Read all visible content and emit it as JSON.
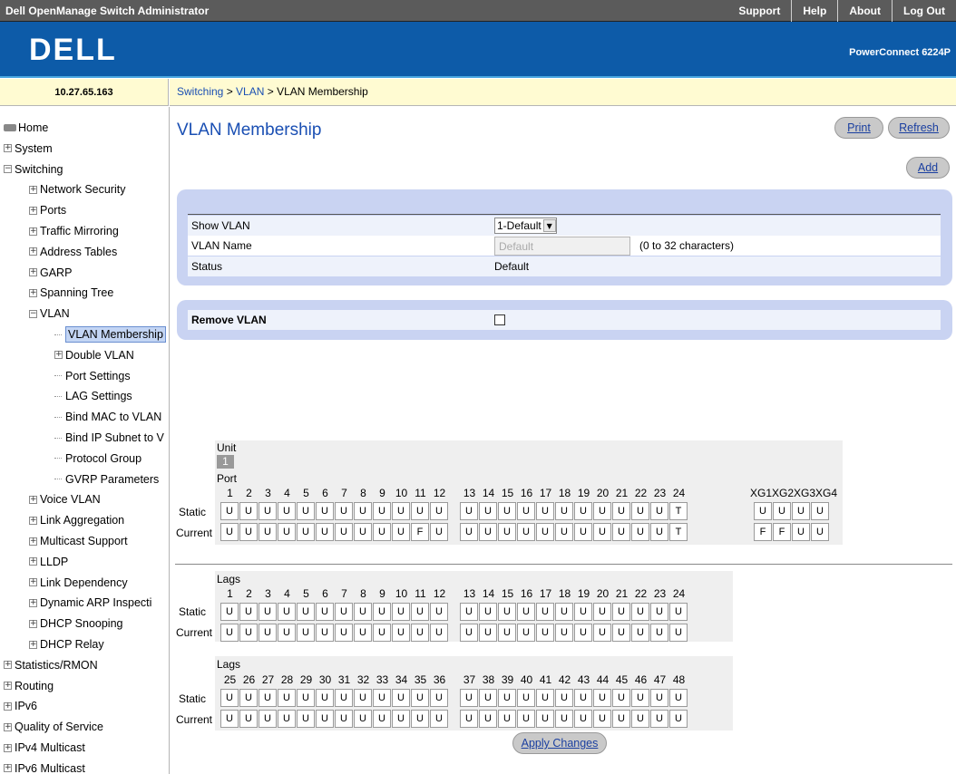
{
  "header": {
    "app_title": "Dell OpenManage Switch Administrator",
    "links": [
      "Support",
      "Help",
      "About",
      "Log Out"
    ],
    "logo": "DELL",
    "model": "PowerConnect 6224P"
  },
  "ip": "10.27.65.163",
  "breadcrumb": [
    "Switching",
    "VLAN",
    "VLAN Membership"
  ],
  "breadcrumb_sep": " > ",
  "sidebar": {
    "items": [
      {
        "label": "Home",
        "level": 0,
        "box": "icon"
      },
      {
        "label": "System",
        "level": 0,
        "box": "+"
      },
      {
        "label": "Switching",
        "level": 0,
        "box": "-"
      },
      {
        "label": "Network Security",
        "level": 1,
        "box": "+"
      },
      {
        "label": "Ports",
        "level": 1,
        "box": "+"
      },
      {
        "label": "Traffic Mirroring",
        "level": 1,
        "box": "+"
      },
      {
        "label": "Address Tables",
        "level": 1,
        "box": "+"
      },
      {
        "label": "GARP",
        "level": 1,
        "box": "+"
      },
      {
        "label": "Spanning Tree",
        "level": 1,
        "box": "+"
      },
      {
        "label": "VLAN",
        "level": 1,
        "box": "-"
      },
      {
        "label": "VLAN Membership",
        "level": 2,
        "box": "",
        "selected": true
      },
      {
        "label": "Double VLAN",
        "level": 2,
        "box": "+"
      },
      {
        "label": "Port Settings",
        "level": 2,
        "box": ""
      },
      {
        "label": "LAG Settings",
        "level": 2,
        "box": ""
      },
      {
        "label": "Bind MAC to VLAN",
        "level": 2,
        "box": ""
      },
      {
        "label": "Bind IP Subnet to V",
        "level": 2,
        "box": ""
      },
      {
        "label": "Protocol Group",
        "level": 2,
        "box": ""
      },
      {
        "label": "GVRP Parameters",
        "level": 2,
        "box": ""
      },
      {
        "label": "Voice VLAN",
        "level": 1,
        "box": "+"
      },
      {
        "label": "Link Aggregation",
        "level": 1,
        "box": "+"
      },
      {
        "label": "Multicast Support",
        "level": 1,
        "box": "+"
      },
      {
        "label": "LLDP",
        "level": 1,
        "box": "+"
      },
      {
        "label": "Link Dependency",
        "level": 1,
        "box": "+"
      },
      {
        "label": "Dynamic ARP Inspecti",
        "level": 1,
        "box": "+"
      },
      {
        "label": "DHCP Snooping",
        "level": 1,
        "box": "+"
      },
      {
        "label": "DHCP Relay",
        "level": 1,
        "box": "+"
      },
      {
        "label": "Statistics/RMON",
        "level": 0,
        "box": "+"
      },
      {
        "label": "Routing",
        "level": 0,
        "box": "+"
      },
      {
        "label": "IPv6",
        "level": 0,
        "box": "+"
      },
      {
        "label": "Quality of Service",
        "level": 0,
        "box": "+"
      },
      {
        "label": "IPv4 Multicast",
        "level": 0,
        "box": "+"
      },
      {
        "label": "IPv6 Multicast",
        "level": 0,
        "box": "+"
      }
    ]
  },
  "main": {
    "title": "VLAN Membership",
    "print_label": "Print",
    "refresh_label": "Refresh",
    "add_label": "Add",
    "show_vlan_label": "Show VLAN",
    "show_vlan_value": "1-Default",
    "vlan_name_label": "VLAN Name",
    "vlan_name_placeholder": "Default",
    "vlan_name_hint": "(0 to 32 characters)",
    "status_label": "Status",
    "status_value": "Default",
    "remove_vlan_label": "Remove VLAN",
    "apply_label": "Apply Changes"
  },
  "ports": {
    "unit_label": "Unit",
    "unit_value": "1",
    "port_label": "Port",
    "static_label": "Static",
    "current_label": "Current",
    "numbers": [
      "1",
      "2",
      "3",
      "4",
      "5",
      "6",
      "7",
      "8",
      "9",
      "10",
      "11",
      "12",
      "13",
      "14",
      "15",
      "16",
      "17",
      "18",
      "19",
      "20",
      "21",
      "22",
      "23",
      "24"
    ],
    "static": [
      "U",
      "U",
      "U",
      "U",
      "U",
      "U",
      "U",
      "U",
      "U",
      "U",
      "U",
      "U",
      "U",
      "U",
      "U",
      "U",
      "U",
      "U",
      "U",
      "U",
      "U",
      "U",
      "U",
      "T"
    ],
    "current": [
      "U",
      "U",
      "U",
      "U",
      "U",
      "U",
      "U",
      "U",
      "U",
      "U",
      "F",
      "U",
      "U",
      "U",
      "U",
      "U",
      "U",
      "U",
      "U",
      "U",
      "U",
      "U",
      "U",
      "T"
    ],
    "xg_header": "XG1XG2XG3XG4",
    "xg_static": [
      "U",
      "U",
      "U",
      "U"
    ],
    "xg_current": [
      "F",
      "F",
      "U",
      "U"
    ]
  },
  "lags1": {
    "label": "Lags",
    "numbers": [
      "1",
      "2",
      "3",
      "4",
      "5",
      "6",
      "7",
      "8",
      "9",
      "10",
      "11",
      "12",
      "13",
      "14",
      "15",
      "16",
      "17",
      "18",
      "19",
      "20",
      "21",
      "22",
      "23",
      "24"
    ],
    "static": [
      "U",
      "U",
      "U",
      "U",
      "U",
      "U",
      "U",
      "U",
      "U",
      "U",
      "U",
      "U",
      "U",
      "U",
      "U",
      "U",
      "U",
      "U",
      "U",
      "U",
      "U",
      "U",
      "U",
      "U"
    ],
    "current": [
      "U",
      "U",
      "U",
      "U",
      "U",
      "U",
      "U",
      "U",
      "U",
      "U",
      "U",
      "U",
      "U",
      "U",
      "U",
      "U",
      "U",
      "U",
      "U",
      "U",
      "U",
      "U",
      "U",
      "U"
    ]
  },
  "lags2": {
    "label": "Lags",
    "numbers": [
      "25",
      "26",
      "27",
      "28",
      "29",
      "30",
      "31",
      "32",
      "33",
      "34",
      "35",
      "36",
      "37",
      "38",
      "39",
      "40",
      "41",
      "42",
      "43",
      "44",
      "45",
      "46",
      "47",
      "48"
    ],
    "static": [
      "U",
      "U",
      "U",
      "U",
      "U",
      "U",
      "U",
      "U",
      "U",
      "U",
      "U",
      "U",
      "U",
      "U",
      "U",
      "U",
      "U",
      "U",
      "U",
      "U",
      "U",
      "U",
      "U",
      "U"
    ],
    "current": [
      "U",
      "U",
      "U",
      "U",
      "U",
      "U",
      "U",
      "U",
      "U",
      "U",
      "U",
      "U",
      "U",
      "U",
      "U",
      "U",
      "U",
      "U",
      "U",
      "U",
      "U",
      "U",
      "U",
      "U"
    ]
  }
}
